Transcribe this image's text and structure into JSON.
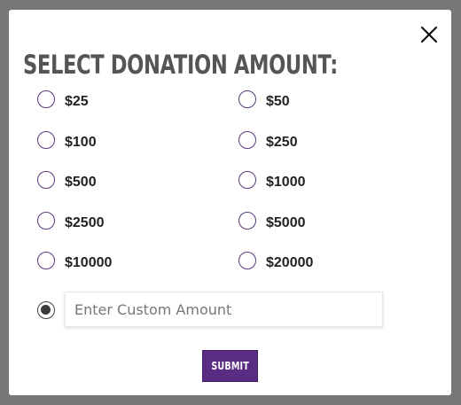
{
  "modal": {
    "title": "SELECT DONATION AMOUNT:",
    "close_icon": "close-x-icon",
    "amounts": [
      "$25",
      "$50",
      "$100",
      "$250",
      "$500",
      "$1000",
      "$2500",
      "$5000",
      "$10000",
      "$20000"
    ],
    "custom": {
      "placeholder": "Enter Custom Amount",
      "value": "",
      "selected": true
    },
    "submit_label": "SUBMIT"
  },
  "colors": {
    "accent": "#5b2c83",
    "overlay": "#777777"
  }
}
